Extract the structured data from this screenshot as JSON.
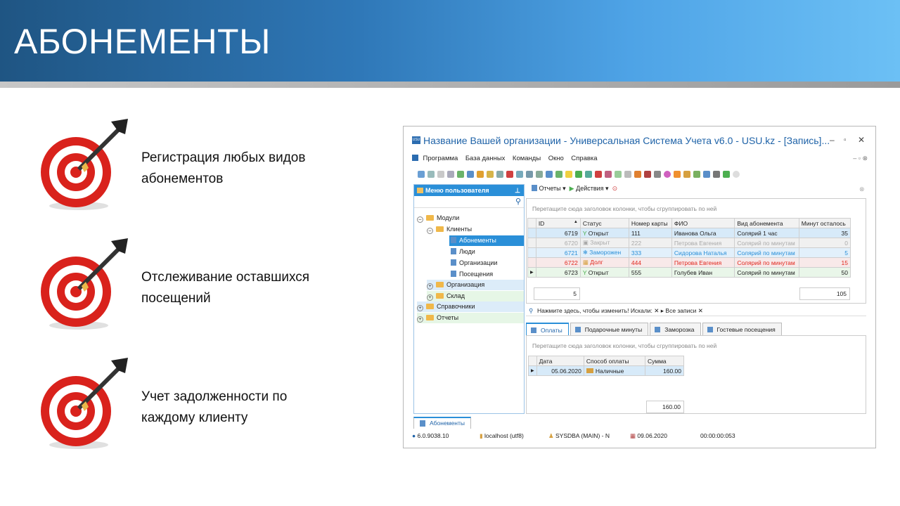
{
  "header": {
    "title": "АБОНЕМЕНТЫ"
  },
  "bullets": [
    {
      "line1": "Регистрация любых видов",
      "line2": "абонементов"
    },
    {
      "line1": "Отслеживание оставшихся",
      "line2": "посещений"
    },
    {
      "line1": "Учет задолженности по",
      "line2": "каждому клиенту"
    }
  ],
  "app": {
    "logo": "USU",
    "title": "Название Вашей организации - Универсальная Система Учета v6.0 - USU.kz - [Запись]...",
    "menu": [
      "Программа",
      "База данных",
      "Команды",
      "Окно",
      "Справка"
    ],
    "left_panel": {
      "title": "Меню пользователя",
      "tree": [
        "Модули",
        "Клиенты",
        "Абонементы",
        "Люди",
        "Организации",
        "Посещения",
        "Организация",
        "Склад",
        "Справочники",
        "Отчеты"
      ]
    },
    "toolbar": {
      "reports": "Отчеты",
      "actions": "Действия"
    },
    "group_hint": "Перетащите сюда заголовок колонки, чтобы сгруппировать по ней",
    "table1": {
      "headers": [
        "ID",
        "Статус",
        "Номер карты",
        "ФИО",
        "Вид абонемента",
        "Минут осталось"
      ],
      "rows": [
        [
          "6719",
          "Открыт",
          "111",
          "Иванова Ольга",
          "Солярий 1 час",
          "35"
        ],
        [
          "6720",
          "Закрыт",
          "222",
          "Петрова Евгения",
          "Солярий по минутам",
          "0"
        ],
        [
          "6721",
          "Заморожен",
          "333",
          "Сидорова Наталья",
          "Солярий по минутам",
          "5"
        ],
        [
          "6722",
          "Долг",
          "444",
          "Петрова Евгения",
          "Солярий по минутам",
          "15"
        ],
        [
          "6723",
          "Открыт",
          "555",
          "Голубев Иван",
          "Солярий по минутам",
          "50"
        ]
      ],
      "count": "5",
      "total": "105"
    },
    "filter": {
      "hint": "Нажмите здесь, чтобы изменить! Искали:",
      "all": "Все записи"
    },
    "tabs": [
      "Оплаты",
      "Подарочные минуты",
      "Заморозка",
      "Гостевые посещения"
    ],
    "table2": {
      "headers": [
        "Дата",
        "Способ оплаты",
        "Сумма"
      ],
      "rows": [
        [
          "05.06.2020",
          "Наличные",
          "160.00"
        ]
      ],
      "total": "160.00"
    },
    "bottom_tab": "Абонементы",
    "status": {
      "version": "6.0.9038.10",
      "server": "localhost (utf8)",
      "user": "SYSDBA (MAIN) - N",
      "date": "09.06.2020",
      "time": "00:00:00:053"
    }
  }
}
